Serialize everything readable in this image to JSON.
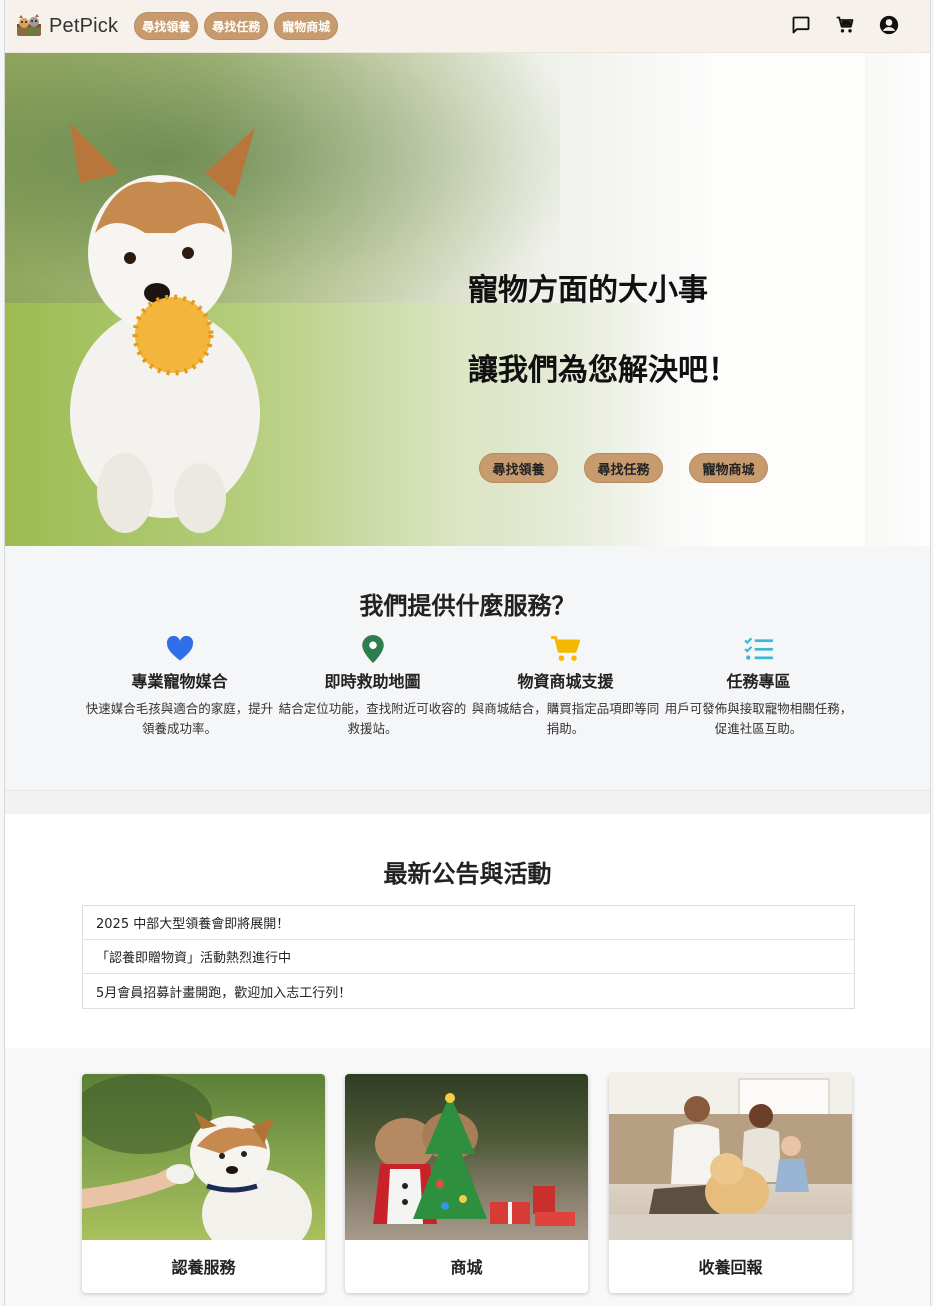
{
  "navbar": {
    "brand": "PetPick",
    "links": [
      "尋找領養",
      "尋找任務",
      "寵物商城"
    ],
    "icons": [
      "chat-icon",
      "cart-icon",
      "account-icon"
    ]
  },
  "hero": {
    "title_line1": "寵物方面的大小事",
    "title_line2": "讓我們為您解決吧！",
    "buttons": [
      "尋找領養",
      "尋找任務",
      "寵物商城"
    ]
  },
  "services": {
    "title": "我們提供什麼服務？",
    "items": [
      {
        "icon": "heart-icon",
        "color": "#2f6fe8",
        "title": "專業寵物媒合",
        "desc": "快速媒合毛孩與適合的家庭，提升領養成功率。"
      },
      {
        "icon": "map-pin-icon",
        "color": "#2e7d4f",
        "title": "即時救助地圖",
        "desc": "結合定位功能，查找附近可收容的救援站。"
      },
      {
        "icon": "cart-icon",
        "color": "#f5b800",
        "title": "物資商城支援",
        "desc": "與商城結合，購買指定品項即等同捐助。"
      },
      {
        "icon": "task-list-icon",
        "color": "#3bb8d6",
        "title": "任務專區",
        "desc": "用戶可發佈與接取寵物相關任務，促進社區互助。"
      }
    ]
  },
  "news": {
    "title": "最新公告與活動",
    "items": [
      "2025 中部大型領養會即將展開！",
      "「認養即贈物資」活動熱烈進行中",
      "5月會員招募計畫開跑，歡迎加入志工行列！"
    ]
  },
  "cards": [
    {
      "label": "認養服務"
    },
    {
      "label": "商城"
    },
    {
      "label": "收養回報"
    }
  ]
}
